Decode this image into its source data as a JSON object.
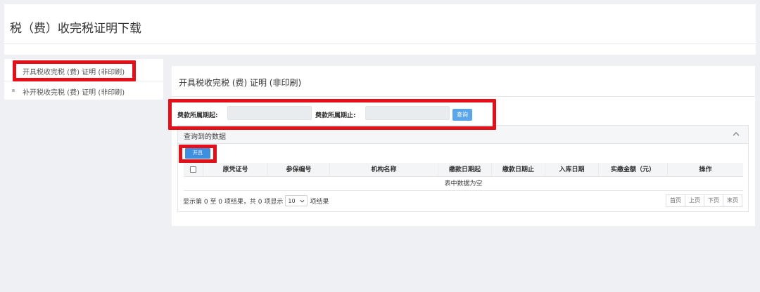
{
  "page": {
    "title": "税（费）收完税证明下载"
  },
  "sidebar": {
    "items": [
      {
        "label": "开具税收完税 (费) 证明 (非印刷)"
      },
      {
        "label": "补开税收完税 (费) 证明 (非印刷)"
      }
    ]
  },
  "panel": {
    "title": "开具税收完税 (费) 证明 (非印刷)",
    "filters": {
      "start_label": "费款所属期起:",
      "start_value": "",
      "end_label": "费款所属期止:",
      "end_value": "",
      "query_label": "查询"
    },
    "results": {
      "title": "查询到的数据",
      "issue_button": "开具",
      "columns": [
        "原凭证号",
        "参保编号",
        "机构名称",
        "缴款日期起",
        "缴款日期止",
        "入库日期",
        "实缴金额（元）",
        "操作"
      ],
      "empty_text": "表中数据为空",
      "info_prefix": "显示第 0 至 0 项结果，共 0 项显示",
      "page_size": "10",
      "info_suffix": "项结果",
      "pager": [
        "首页",
        "上页",
        "下页",
        "末页"
      ]
    }
  },
  "colors": {
    "highlight": "#e3101a",
    "primary_button": "#5aa6ea",
    "issue_button": "#3e8fe0"
  },
  "icons": {
    "collapse": "chevron-up-icon",
    "dropdown": "chevron-down-icon"
  }
}
